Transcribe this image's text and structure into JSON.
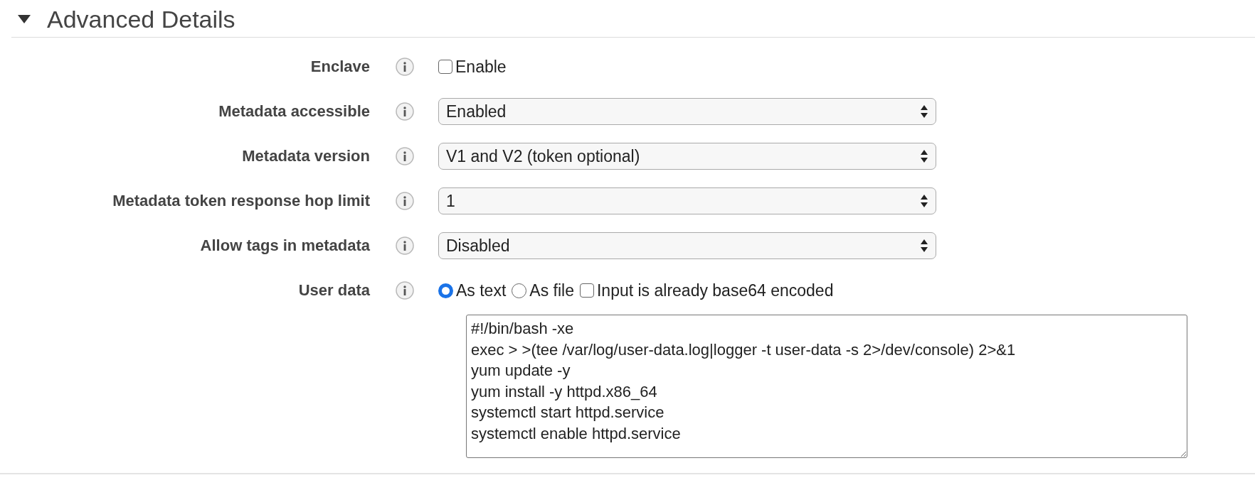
{
  "section": {
    "title": "Advanced Details",
    "expanded": true
  },
  "rows": [
    {
      "kind": "checkbox",
      "label": "Enclave",
      "option": {
        "label": "Enable",
        "checked": false
      }
    },
    {
      "kind": "select",
      "label": "Metadata accessible",
      "value": "Enabled"
    },
    {
      "kind": "select",
      "label": "Metadata version",
      "value": "V1 and V2 (token optional)"
    },
    {
      "kind": "select",
      "label": "Metadata token response hop limit",
      "value": "1"
    },
    {
      "kind": "select",
      "label": "Allow tags in metadata",
      "value": "Disabled"
    },
    {
      "kind": "choices",
      "label": "User data",
      "options": [
        {
          "kind": "radio",
          "label": "As text",
          "selected": true
        },
        {
          "kind": "radio",
          "label": "As file",
          "selected": false
        },
        {
          "kind": "checkbox",
          "label": "Input is already base64 encoded",
          "checked": false
        }
      ]
    }
  ],
  "user_data": {
    "value": "#!/bin/bash -xe\nexec > >(tee /var/log/user-data.log|logger -t user-data -s 2>/dev/console) 2>&1\nyum update -y\nyum install -y httpd.x86_64\nsystemctl start httpd.service\nsystemctl enable httpd.service"
  }
}
